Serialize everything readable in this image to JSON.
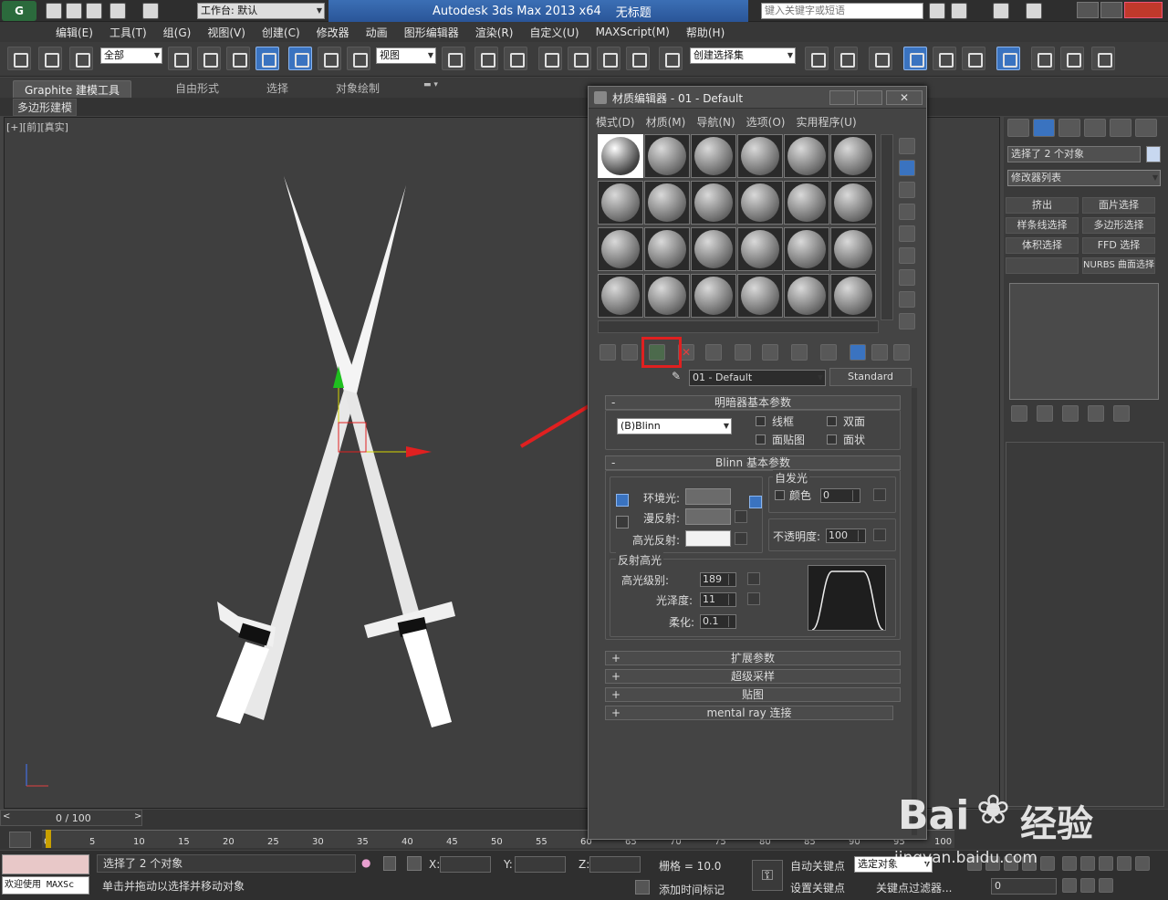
{
  "app": {
    "title": "Autodesk 3ds Max  2013 x64",
    "file_title": "无标题",
    "workspace_label": "工作台: 默认",
    "search_placeholder": "键入关键字或短语"
  },
  "menu": [
    "编辑(E)",
    "工具(T)",
    "组(G)",
    "视图(V)",
    "创建(C)",
    "修改器",
    "动画",
    "图形编辑器",
    "渲染(R)",
    "自定义(U)",
    "MAXScript(M)",
    "帮助(H)"
  ],
  "toolbar": {
    "selection_filter": "全部",
    "ref_coord": "视图",
    "named_selection": "创建选择集"
  },
  "ribbon": {
    "tabs": [
      "Graphite 建模工具",
      "自由形式",
      "选择",
      "对象绘制"
    ],
    "sub_label": "多边形建模"
  },
  "viewport": {
    "label": "[+][前][真实]"
  },
  "material_editor": {
    "title": "材质编辑器 - 01 - Default",
    "menu": [
      "模式(D)",
      "材质(M)",
      "导航(N)",
      "选项(O)",
      "实用程序(U)"
    ],
    "material_name": "01 - Default",
    "material_type": "Standard",
    "shader_rollout": "明暗器基本参数",
    "shader": "(B)Blinn",
    "shader_options": [
      "线框",
      "双面",
      "面贴图",
      "面状"
    ],
    "blinn_rollout": "Blinn 基本参数",
    "self_illum_group": "自发光",
    "color_label": "颜色",
    "self_illum_value": "0",
    "ambient_label": "环境光:",
    "diffuse_label": "漫反射:",
    "specular_label": "高光反射:",
    "opacity_label": "不透明度:",
    "opacity_value": "100",
    "spec_group": "反射高光",
    "spec_level_label": "高光级别:",
    "spec_level_value": "189",
    "gloss_label": "光泽度:",
    "gloss_value": "11",
    "soften_label": "柔化:",
    "soften_value": "0.1",
    "collapsed_rollouts": [
      "扩展参数",
      "超级采样",
      "贴图",
      "mental ray 连接"
    ]
  },
  "command_panel": {
    "selection_text": "选择了 2 个对象",
    "modifier_list": "修改器列表",
    "buttons": [
      "挤出",
      "面片选择",
      "样条线选择",
      "多边形选择",
      "体积选择",
      "FFD 选择",
      "",
      "NURBS 曲面选择"
    ]
  },
  "timeline": {
    "frame": "0 / 100",
    "ticks": [
      "0",
      "5",
      "10",
      "15",
      "20",
      "25",
      "30",
      "35",
      "40",
      "45",
      "50",
      "55",
      "60",
      "65",
      "70",
      "75",
      "80",
      "85",
      "90",
      "95",
      "100"
    ]
  },
  "status": {
    "welcome": "欢迎使用 MAXSc",
    "selected": "选择了 2 个对象",
    "hint": "单击并拖动以选择并移动对象",
    "x_label": "X:",
    "y_label": "Y:",
    "z_label": "Z:",
    "grid": "栅格 = 10.0",
    "add_time_tag": "添加时间标记",
    "auto_key": "自动关键点",
    "set_key": "设置关键点",
    "selected_obj": "选定对象",
    "key_filters": "关键点过滤器...",
    "frame_field": "0"
  },
  "watermark": {
    "brand": "Bai",
    "cn": "经验",
    "url": "jingyan.baidu.com"
  },
  "colors": {
    "highlight_red": "#e02020",
    "accent_blue": "#3a73c0"
  }
}
